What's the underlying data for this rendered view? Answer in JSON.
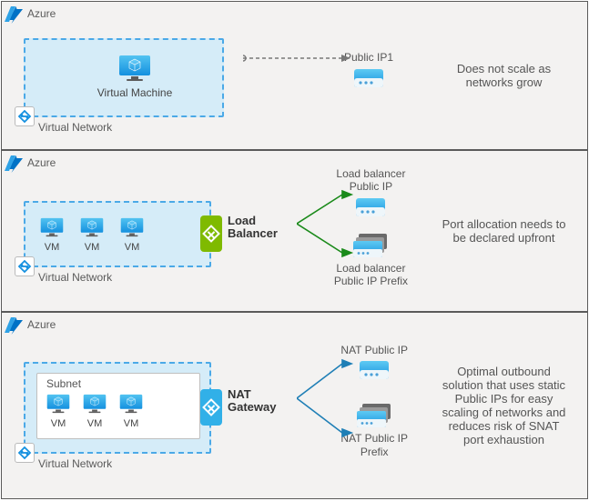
{
  "common": {
    "azure_label": "Azure",
    "vnet_label": "Virtual Network",
    "vm_label_short": "VM",
    "vm_label_long": "Virtual Machine",
    "subnet_label": "Subnet"
  },
  "sections": [
    {
      "id": "single-vm",
      "public_ip_label": "Public IP1",
      "description": "Does not scale as networks grow"
    },
    {
      "id": "load-balancer",
      "device_label": "Load\nBalancer",
      "ip_label": "Load balancer\nPublic IP",
      "prefix_label": "Load balancer\nPublic IP Prefix",
      "description": "Port allocation needs to be declared upfront"
    },
    {
      "id": "nat-gateway",
      "device_label": "NAT\nGateway",
      "ip_label": "NAT Public IP",
      "prefix_label": "NAT Public IP\nPrefix",
      "description": "Optimal outbound solution that uses static Public IPs for easy scaling of networks and reduces risk of SNAT port exhaustion"
    }
  ]
}
